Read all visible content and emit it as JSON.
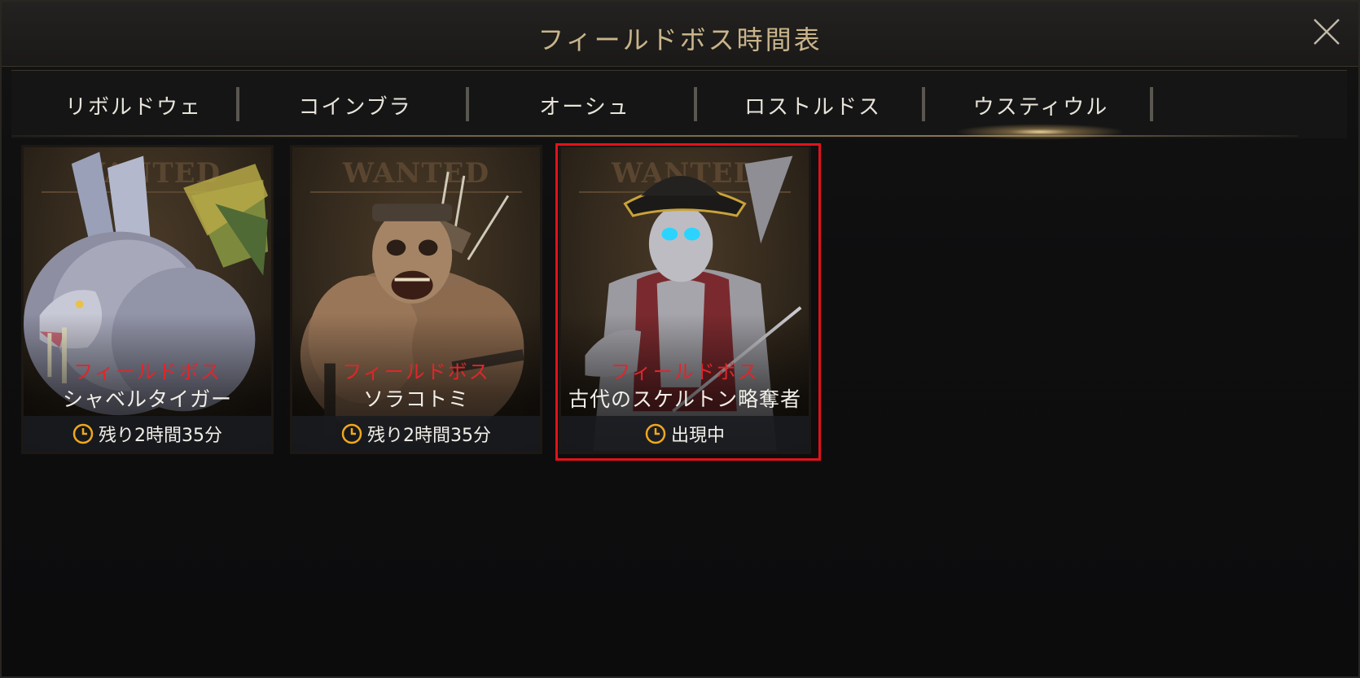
{
  "window": {
    "title": "フィールドボス時間表",
    "close_icon": "close-icon"
  },
  "tabs": [
    {
      "label": "リボルドウェ",
      "active": false
    },
    {
      "label": "コインブラ",
      "active": false
    },
    {
      "label": "オーシュ",
      "active": false
    },
    {
      "label": "ロストルドス",
      "active": false
    },
    {
      "label": "ウスティウル",
      "active": true
    }
  ],
  "cards": [
    {
      "wanted": "WANTED",
      "type": "フィールドボス",
      "name": "シャベルタイガー",
      "status": "残り2時間35分",
      "icon": "clock-icon",
      "selected": false
    },
    {
      "wanted": "WANTED",
      "type": "フィールドボス",
      "name": "ソラコトミ",
      "status": "残り2時間35分",
      "icon": "clock-icon",
      "selected": false
    },
    {
      "wanted": "WANTED",
      "type": "フィールドボス",
      "name": "古代のスケルトン略奪者",
      "status": "出現中",
      "icon": "clock-icon",
      "selected": true
    }
  ],
  "colors": {
    "title": "#c9b48a",
    "boss_type": "#e0262a",
    "selected_border": "#e3121a",
    "clock": "#f0a81c"
  }
}
